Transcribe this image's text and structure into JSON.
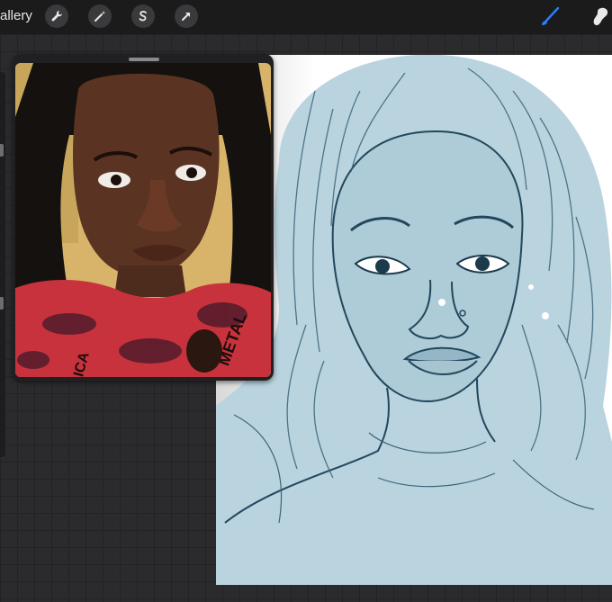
{
  "toolbar": {
    "gallery_label": "allery",
    "left_tools": [
      "wrench-icon",
      "magic-wand-icon",
      "selection-s-icon",
      "transform-arrow-icon"
    ],
    "right_tools": [
      "brush-icon",
      "smudge-icon"
    ],
    "active_color": "#1a73e8"
  },
  "reference": {
    "shirt_text_a": "METAL",
    "shirt_text_b": "LICA"
  },
  "colors": {
    "sketch_fill": "#b9d3df",
    "sketch_line": "#22475c",
    "shirt_red": "#c8323c"
  }
}
